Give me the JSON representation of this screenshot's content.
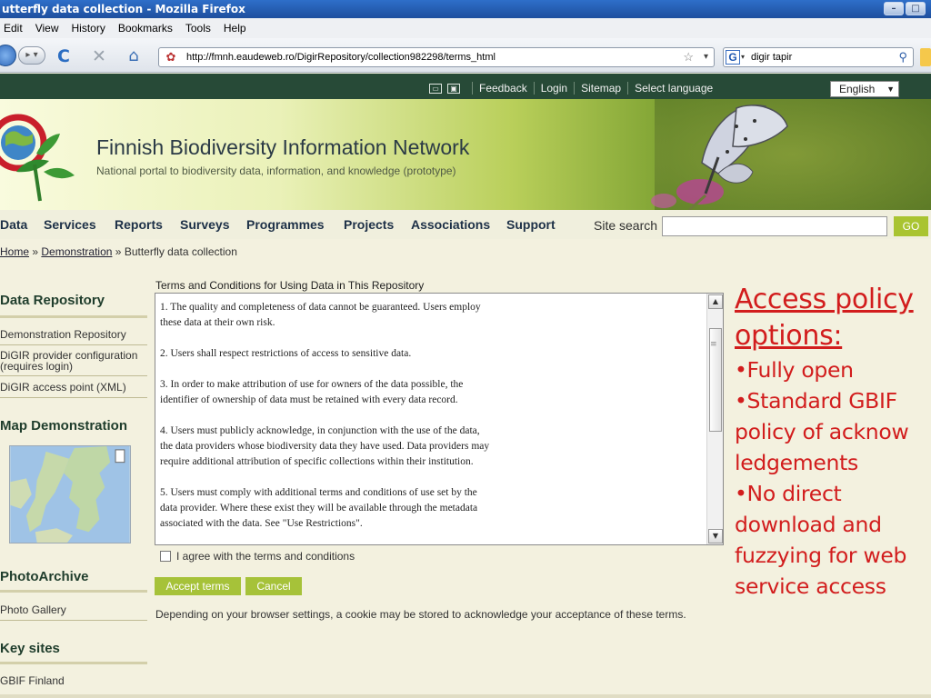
{
  "window": {
    "title": "utterfly data collection - Mozilla Firefox",
    "controls": [
      "–",
      "□"
    ]
  },
  "menu": [
    "Edit",
    "View",
    "History",
    "Bookmarks",
    "Tools",
    "Help"
  ],
  "navbar": {
    "url": "http://fmnh.eaudeweb.ro/DigirRepository/collection982298/terms_html",
    "search_value": "digir tapir"
  },
  "site_top": {
    "links": [
      "Feedback",
      "Login",
      "Sitemap",
      "Select language"
    ],
    "language": "English"
  },
  "banner": {
    "title": "Finnish Biodiversity Information Network",
    "subtitle": "National portal to biodiversity data, information, and knowledge (prototype)"
  },
  "mainnav": {
    "items": [
      "Data",
      "Services",
      "Reports",
      "Surveys",
      "Programmes",
      "Projects",
      "Associations",
      "Support"
    ],
    "search_label": "Site search",
    "go_label": "GO"
  },
  "breadcrumb": {
    "home": "Home",
    "sep": "»",
    "demo": "Demonstration",
    "current": "Butterfly data collection"
  },
  "sidebar": {
    "data_repository": {
      "heading": "Data Repository",
      "links": [
        "Demonstration Repository",
        "DiGIR provider configuration (requires login)",
        "DiGIR access point (XML)"
      ]
    },
    "map_demo": {
      "heading": "Map Demonstration"
    },
    "photo_archive": {
      "heading": "PhotoArchive",
      "links": [
        "Photo Gallery"
      ]
    },
    "key_sites": {
      "heading": "Key sites",
      "links": [
        "GBIF Finland"
      ]
    }
  },
  "terms": {
    "caption": "Terms and Conditions for Using Data in This Repository",
    "paragraphs": [
      "1. The quality and completeness of data cannot be guaranteed. Users employ\nthese data at their own risk.",
      "2. Users shall respect restrictions of access to sensitive data.",
      "3. In order to make attribution of use for owners of the data possible, the\nidentifier of ownership of data must be retained with every data record.",
      "4. Users must publicly acknowledge, in conjunction with the use of the data,\nthe data providers whose biodiversity data they have used. Data providers may\nrequire additional attribution of specific collections within their institution.",
      "5. Users must comply with additional terms and conditions of use set by the\ndata provider. Where these exist they will be available through the metadata\nassociated with the data.  See \"Use Restrictions\"."
    ],
    "agree_label": "I agree with the terms and conditions",
    "accept_label": "Accept terms",
    "cancel_label": "Cancel",
    "cookie_note": "Depending on your browser settings, a cookie may be stored to acknowledge your acceptance of these terms."
  },
  "annotation": {
    "title_lines": [
      "Access policy",
      "options:"
    ],
    "items": [
      "•Fully open",
      "•Standard GBIF",
      "policy of acknow",
      "ledgements",
      "•No direct",
      "download and",
      "fuzzying for web",
      "service access"
    ]
  },
  "colors": {
    "annotation": "#d21d1d",
    "button_green": "#a6c239",
    "site_bar": "#274a37"
  }
}
